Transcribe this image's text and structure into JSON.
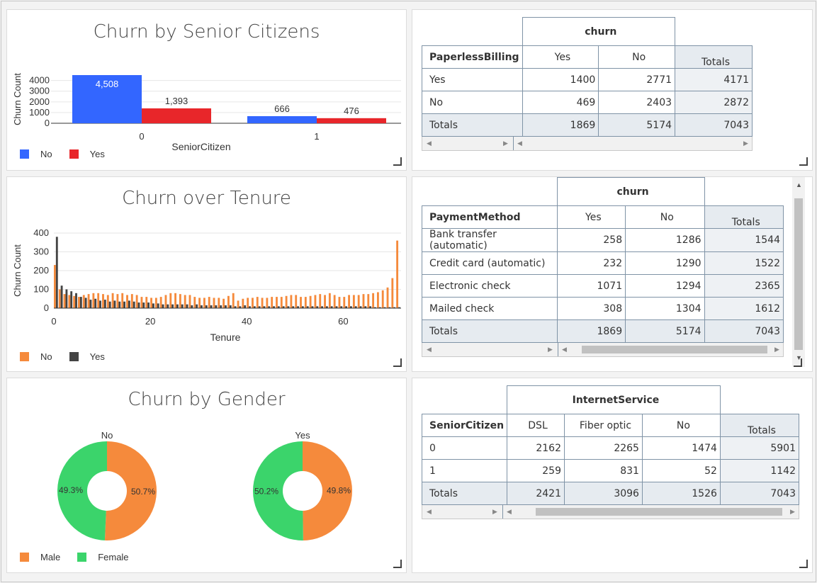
{
  "charts": {
    "senior": {
      "title": "Churn by Senior Citizens",
      "ylabel": "Churn Count",
      "xlabel": "SeniorCitizen",
      "yticks": [
        "4000",
        "3000",
        "2000",
        "1000",
        "0"
      ],
      "xticks": [
        "0",
        "1"
      ],
      "legend": [
        {
          "label": "No",
          "color": "#3366ff"
        },
        {
          "label": "Yes",
          "color": "#e8262a"
        }
      ],
      "chart_data": {
        "type": "bar",
        "categories": [
          "0",
          "1"
        ],
        "series": [
          {
            "name": "No",
            "values": [
              4508,
              666
            ],
            "labels": [
              "4,508",
              "666"
            ]
          },
          {
            "name": "Yes",
            "values": [
              1393,
              476
            ],
            "labels": [
              "1,393",
              "476"
            ]
          }
        ],
        "ylim": [
          0,
          4508
        ]
      }
    },
    "tenure": {
      "title": "Churn over Tenure",
      "ylabel": "Churn Count",
      "xlabel": "Tenure",
      "yticks": [
        "400",
        "300",
        "200",
        "100",
        "0"
      ],
      "xticks": [
        "0",
        "20",
        "40",
        "60"
      ],
      "legend": [
        {
          "label": "No",
          "color": "#f58a3c"
        },
        {
          "label": "Yes",
          "color": "#444444"
        }
      ],
      "chart_data": {
        "type": "bar",
        "x_range": [
          0,
          72
        ],
        "ylim": [
          0,
          400
        ],
        "series": [
          {
            "name": "No",
            "values": [
              230,
              100,
              75,
              70,
              65,
              60,
              70,
              75,
              80,
              80,
              75,
              70,
              80,
              75,
              80,
              70,
              75,
              70,
              60,
              60,
              55,
              55,
              60,
              70,
              80,
              80,
              75,
              70,
              70,
              60,
              55,
              55,
              60,
              55,
              55,
              50,
              65,
              80,
              40,
              50,
              55,
              55,
              60,
              55,
              55,
              60,
              60,
              60,
              65,
              70,
              70,
              60,
              60,
              65,
              70,
              75,
              70,
              80,
              70,
              60,
              60,
              70,
              70,
              70,
              75,
              75,
              80,
              85,
              95,
              110,
              160,
              360
            ]
          },
          {
            "name": "Yes",
            "values": [
              380,
              120,
              100,
              90,
              80,
              60,
              55,
              45,
              50,
              40,
              45,
              35,
              40,
              35,
              35,
              40,
              35,
              30,
              30,
              30,
              25,
              25,
              20,
              20,
              20,
              20,
              20,
              20,
              15,
              20,
              15,
              15,
              15,
              15,
              15,
              15,
              15,
              10,
              10,
              15,
              10,
              10,
              10,
              10,
              10,
              10,
              10,
              10,
              10,
              10,
              10,
              10,
              10,
              10,
              10,
              10,
              10,
              10,
              10,
              10,
              10,
              10,
              10,
              10,
              10,
              10,
              5,
              5,
              5,
              5,
              5,
              5
            ]
          }
        ]
      }
    },
    "gender": {
      "title": "Churn by Gender",
      "legend": [
        {
          "label": "Male",
          "color": "#f58a3c"
        },
        {
          "label": "Female",
          "color": "#3bd46b"
        }
      ],
      "chart_data": {
        "type": "pie",
        "pies": [
          {
            "name": "No",
            "slices": [
              {
                "label": "Male",
                "value": 50.7,
                "text": "50.7%"
              },
              {
                "label": "Female",
                "value": 49.3,
                "text": "49.3%"
              }
            ]
          },
          {
            "name": "Yes",
            "slices": [
              {
                "label": "Male",
                "value": 49.8,
                "text": "49.8%"
              },
              {
                "label": "Female",
                "value": 50.2,
                "text": "50.2%"
              }
            ]
          }
        ]
      }
    }
  },
  "tables": {
    "paperless": {
      "col_field": "churn",
      "row_field": "PaperlessBilling",
      "columns": [
        "Yes",
        "No",
        "Totals"
      ],
      "rows": [
        {
          "label": "Yes",
          "values": [
            "1400",
            "2771",
            "4171"
          ]
        },
        {
          "label": "No",
          "values": [
            "469",
            "2403",
            "2872"
          ]
        }
      ],
      "totals": {
        "label": "Totals",
        "values": [
          "1869",
          "5174",
          "7043"
        ]
      }
    },
    "payment": {
      "col_field": "churn",
      "row_field": "PaymentMethod",
      "columns": [
        "Yes",
        "No",
        "Totals"
      ],
      "rows": [
        {
          "label": "Bank transfer (automatic)",
          "values": [
            "258",
            "1286",
            "1544"
          ]
        },
        {
          "label": "Credit card (automatic)",
          "values": [
            "232",
            "1290",
            "1522"
          ]
        },
        {
          "label": "Electronic check",
          "values": [
            "1071",
            "1294",
            "2365"
          ]
        },
        {
          "label": "Mailed check",
          "values": [
            "308",
            "1304",
            "1612"
          ]
        }
      ],
      "totals": {
        "label": "Totals",
        "values": [
          "1869",
          "5174",
          "7043"
        ]
      }
    },
    "internet": {
      "col_field": "InternetService",
      "row_field": "SeniorCitizen",
      "columns": [
        "DSL",
        "Fiber optic",
        "No",
        "Totals"
      ],
      "rows": [
        {
          "label": "0",
          "values": [
            "2162",
            "2265",
            "1474",
            "5901"
          ]
        },
        {
          "label": "1",
          "values": [
            "259",
            "831",
            "52",
            "1142"
          ]
        }
      ],
      "totals": {
        "label": "Totals",
        "values": [
          "2421",
          "3096",
          "1526",
          "7043"
        ]
      }
    }
  }
}
